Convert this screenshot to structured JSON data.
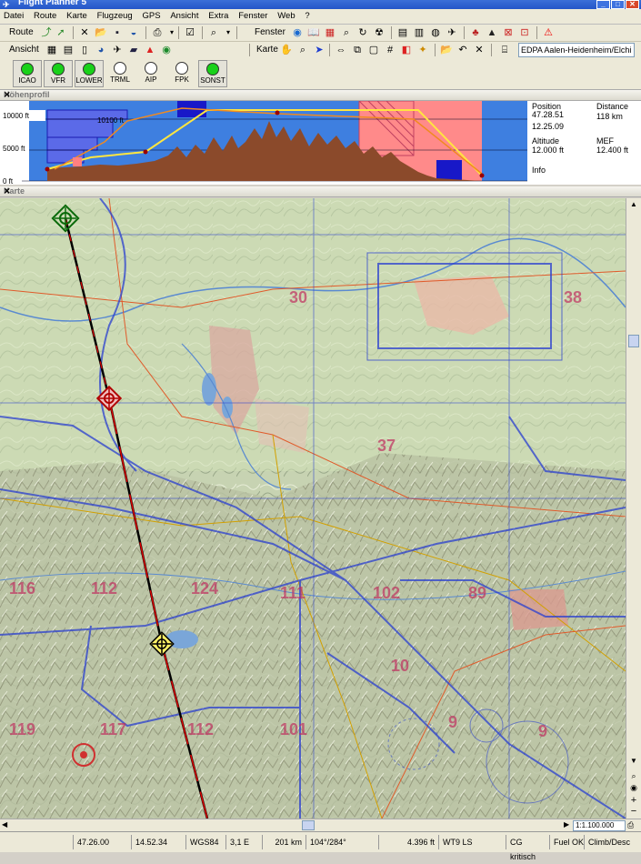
{
  "window": {
    "title": "Flight Planner 5"
  },
  "menu": [
    "Datei",
    "Route",
    "Karte",
    "Flugzeug",
    "GPS",
    "Ansicht",
    "Extra",
    "Fenster",
    "Web",
    "?"
  ],
  "toolbars": {
    "route_label": "Route",
    "fenster_label": "Fenster",
    "ansicht_label": "Ansicht",
    "karte_label": "Karte",
    "airfield_field": "EDPA Aalen-Heidenheim/Elchin"
  },
  "airspace_buttons": [
    {
      "label": "ICAO",
      "on": true
    },
    {
      "label": "VFR",
      "on": true
    },
    {
      "label": "LOWER",
      "on": true
    },
    {
      "label": "TRML",
      "on": false
    },
    {
      "label": "AIP",
      "on": false
    },
    {
      "label": "FPK",
      "on": false
    },
    {
      "label": "SONST",
      "on": true
    }
  ],
  "profile": {
    "header": "Höhenprofil",
    "alt_labels": [
      "10000 ft",
      "5000 ft",
      "0 ft"
    ],
    "block_label": "10100 ft",
    "position_label": "Position",
    "position_value": "47.28.51",
    "position_value2": "12.25.09",
    "distance_label": "Distance",
    "distance_value": "118 km",
    "altitude_label": "Altitude",
    "altitude_value": "12.000 ft",
    "mef_label": "MEF",
    "mef_value": "12.400 ft",
    "info_label": "Info"
  },
  "map": {
    "header": "Karte",
    "scale": "1:1.100.000",
    "grid_numbers": [
      "30",
      "38",
      "37",
      "116",
      "112",
      "124",
      "111",
      "102",
      "89",
      "10",
      "9",
      "9",
      "119",
      "117",
      "112",
      "101"
    ]
  },
  "status": {
    "lat": "47.26.00",
    "lon": "14.52.34",
    "datum": "WGS84",
    "variation": "3,1 E",
    "distance": "201 km",
    "course": "104°/284°",
    "altitude": "4.396 ft",
    "weather": "WT9 LS",
    "cg": "CG kritisch",
    "fuel": "Fuel OK",
    "climb": "Climb/Desc"
  },
  "colors": {
    "titlebar": "#2456c8",
    "route_black": "#000000",
    "route_red": "#e00000",
    "terrain": "#8b4a2b",
    "restricted": "#ff8a8a",
    "airspace_blue": "#2a3fd0",
    "green_dot": "#19d119"
  }
}
